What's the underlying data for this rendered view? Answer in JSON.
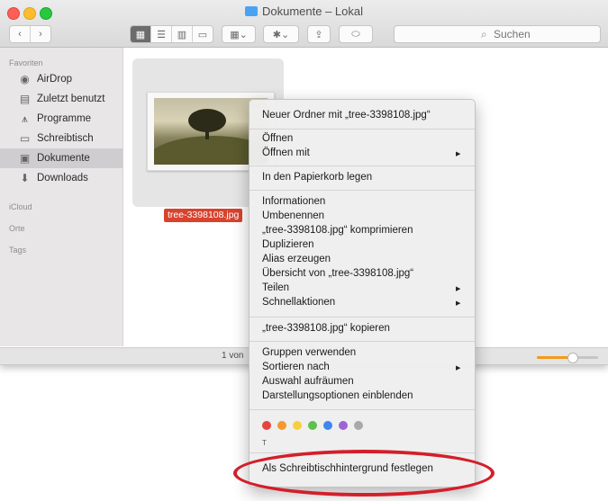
{
  "window": {
    "title": "Dokumente – Lokal",
    "search_placeholder": "Suchen",
    "status_text": "1 von"
  },
  "sidebar": {
    "sections": {
      "favoriten": "Favoriten",
      "icloud": "iCloud",
      "orte": "Orte",
      "tags": "Tags"
    },
    "items": [
      {
        "label": "AirDrop",
        "icon": "airdrop-icon"
      },
      {
        "label": "Zuletzt benutzt",
        "icon": "recents-icon"
      },
      {
        "label": "Programme",
        "icon": "applications-icon"
      },
      {
        "label": "Schreibtisch",
        "icon": "desktop-icon"
      },
      {
        "label": "Dokumente",
        "icon": "documents-icon",
        "selected": true
      },
      {
        "label": "Downloads",
        "icon": "downloads-icon"
      }
    ]
  },
  "file": {
    "name": "tree-3398108.jpg"
  },
  "context_menu": {
    "new_folder": "Neuer Ordner mit „tree-3398108.jpg“",
    "open": "Öffnen",
    "open_with": "Öffnen mit",
    "trash": "In den Papierkorb legen",
    "info": "Informationen",
    "rename": "Umbenennen",
    "compress": "„tree-3398108.jpg“ komprimieren",
    "duplicate": "Duplizieren",
    "alias": "Alias erzeugen",
    "quicklook": "Übersicht von „tree-3398108.jpg“",
    "share": "Teilen",
    "quick_actions": "Schnellaktionen",
    "copy": "„tree-3398108.jpg“ kopieren",
    "use_groups": "Gruppen verwenden",
    "sort_by": "Sortieren nach",
    "clean_up": "Auswahl aufräumen",
    "view_options": "Darstellungsoptionen einblenden",
    "tags_label": "T",
    "set_desktop": "Als Schreibtischhintergrund festlegen",
    "tag_colors": [
      "#e3463d",
      "#f39a2c",
      "#f6cf3b",
      "#5fc04c",
      "#3e86f0",
      "#9c63d6",
      "#a9a9a9"
    ]
  },
  "colors": {
    "highlight_oval": "#d21f2a",
    "filename_badge": "#d7432e"
  }
}
